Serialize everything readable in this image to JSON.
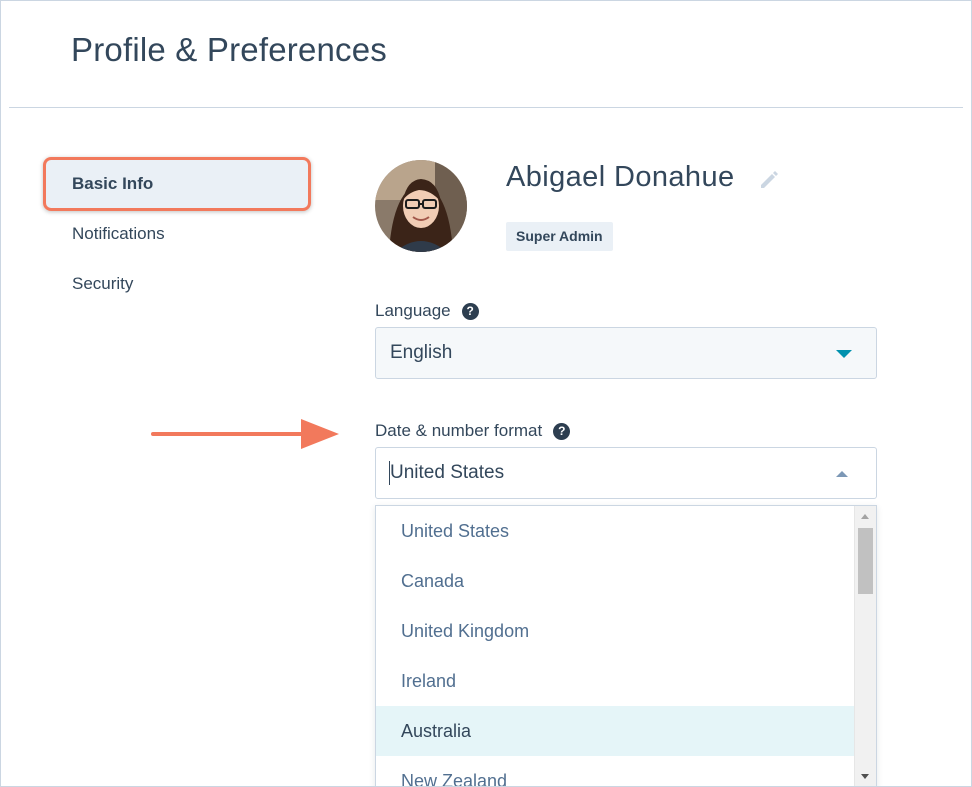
{
  "page": {
    "title": "Profile & Preferences"
  },
  "sidebar": {
    "items": [
      {
        "label": "Basic Info",
        "active": true
      },
      {
        "label": "Notifications",
        "active": false
      },
      {
        "label": "Security",
        "active": false
      }
    ]
  },
  "profile": {
    "name": "Abigael Donahue",
    "role": "Super Admin",
    "edit_icon": "pencil-icon",
    "avatar_icon": "user-avatar"
  },
  "language": {
    "label": "Language",
    "value": "English",
    "help_glyph": "?"
  },
  "date_format": {
    "label": "Date & number format",
    "value": "United States",
    "help_glyph": "?",
    "options": [
      "United States",
      "Canada",
      "United Kingdom",
      "Ireland",
      "Australia",
      "New Zealand"
    ],
    "highlighted": "Australia"
  },
  "colors": {
    "accent": "#0091ae",
    "annotation": "#f2795c",
    "text": "#33475b",
    "highlight_bg": "#e5f5f8"
  }
}
